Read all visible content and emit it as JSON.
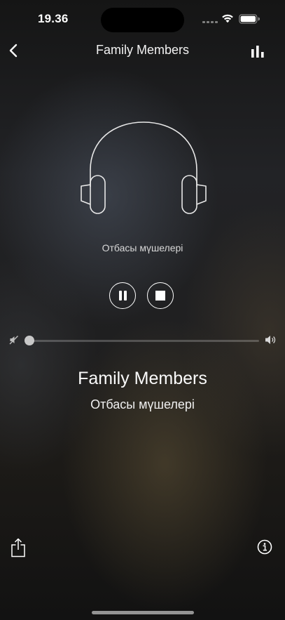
{
  "status_bar": {
    "time": "19.36"
  },
  "nav": {
    "title": "Family Members",
    "back_icon": "chevron-left-icon",
    "stats_icon": "bar-chart-icon"
  },
  "artwork": {
    "icon": "headphones-icon",
    "caption": "Отбасы мүшелері"
  },
  "controls": {
    "pause_icon": "pause-icon",
    "stop_icon": "stop-icon"
  },
  "volume": {
    "level": 0.0,
    "min_icon": "mute-icon",
    "max_icon": "speaker-icon"
  },
  "track": {
    "title": "Family Members",
    "subtitle": "Отбасы мүшелері"
  },
  "bottom": {
    "share_icon": "share-icon",
    "info_icon": "info-icon"
  },
  "colors": {
    "foreground": "#ffffff",
    "background": "#1b1b1c"
  }
}
